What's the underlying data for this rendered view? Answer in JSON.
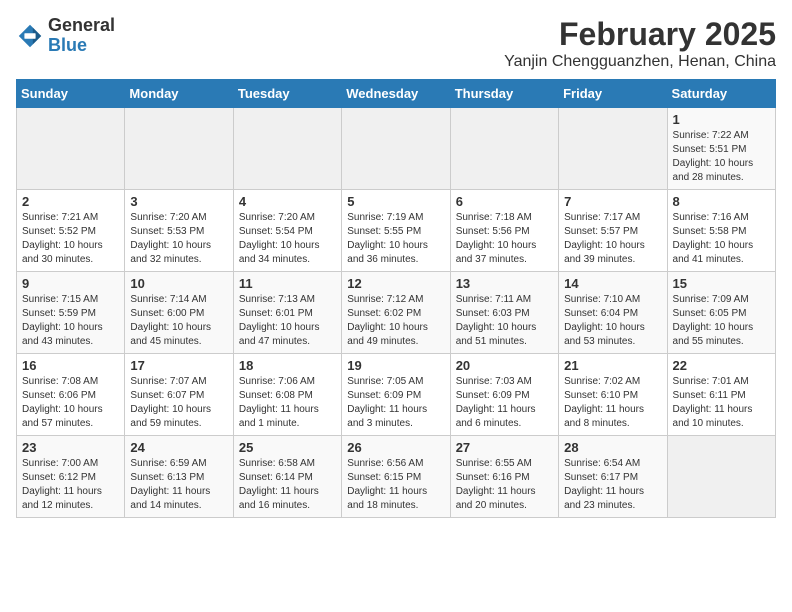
{
  "logo": {
    "general": "General",
    "blue": "Blue"
  },
  "title": "February 2025",
  "subtitle": "Yanjin Chengguanzhen, Henan, China",
  "weekdays": [
    "Sunday",
    "Monday",
    "Tuesday",
    "Wednesday",
    "Thursday",
    "Friday",
    "Saturday"
  ],
  "weeks": [
    [
      {
        "day": "",
        "info": ""
      },
      {
        "day": "",
        "info": ""
      },
      {
        "day": "",
        "info": ""
      },
      {
        "day": "",
        "info": ""
      },
      {
        "day": "",
        "info": ""
      },
      {
        "day": "",
        "info": ""
      },
      {
        "day": "1",
        "info": "Sunrise: 7:22 AM\nSunset: 5:51 PM\nDaylight: 10 hours and 28 minutes."
      }
    ],
    [
      {
        "day": "2",
        "info": "Sunrise: 7:21 AM\nSunset: 5:52 PM\nDaylight: 10 hours and 30 minutes."
      },
      {
        "day": "3",
        "info": "Sunrise: 7:20 AM\nSunset: 5:53 PM\nDaylight: 10 hours and 32 minutes."
      },
      {
        "day": "4",
        "info": "Sunrise: 7:20 AM\nSunset: 5:54 PM\nDaylight: 10 hours and 34 minutes."
      },
      {
        "day": "5",
        "info": "Sunrise: 7:19 AM\nSunset: 5:55 PM\nDaylight: 10 hours and 36 minutes."
      },
      {
        "day": "6",
        "info": "Sunrise: 7:18 AM\nSunset: 5:56 PM\nDaylight: 10 hours and 37 minutes."
      },
      {
        "day": "7",
        "info": "Sunrise: 7:17 AM\nSunset: 5:57 PM\nDaylight: 10 hours and 39 minutes."
      },
      {
        "day": "8",
        "info": "Sunrise: 7:16 AM\nSunset: 5:58 PM\nDaylight: 10 hours and 41 minutes."
      }
    ],
    [
      {
        "day": "9",
        "info": "Sunrise: 7:15 AM\nSunset: 5:59 PM\nDaylight: 10 hours and 43 minutes."
      },
      {
        "day": "10",
        "info": "Sunrise: 7:14 AM\nSunset: 6:00 PM\nDaylight: 10 hours and 45 minutes."
      },
      {
        "day": "11",
        "info": "Sunrise: 7:13 AM\nSunset: 6:01 PM\nDaylight: 10 hours and 47 minutes."
      },
      {
        "day": "12",
        "info": "Sunrise: 7:12 AM\nSunset: 6:02 PM\nDaylight: 10 hours and 49 minutes."
      },
      {
        "day": "13",
        "info": "Sunrise: 7:11 AM\nSunset: 6:03 PM\nDaylight: 10 hours and 51 minutes."
      },
      {
        "day": "14",
        "info": "Sunrise: 7:10 AM\nSunset: 6:04 PM\nDaylight: 10 hours and 53 minutes."
      },
      {
        "day": "15",
        "info": "Sunrise: 7:09 AM\nSunset: 6:05 PM\nDaylight: 10 hours and 55 minutes."
      }
    ],
    [
      {
        "day": "16",
        "info": "Sunrise: 7:08 AM\nSunset: 6:06 PM\nDaylight: 10 hours and 57 minutes."
      },
      {
        "day": "17",
        "info": "Sunrise: 7:07 AM\nSunset: 6:07 PM\nDaylight: 10 hours and 59 minutes."
      },
      {
        "day": "18",
        "info": "Sunrise: 7:06 AM\nSunset: 6:08 PM\nDaylight: 11 hours and 1 minute."
      },
      {
        "day": "19",
        "info": "Sunrise: 7:05 AM\nSunset: 6:09 PM\nDaylight: 11 hours and 3 minutes."
      },
      {
        "day": "20",
        "info": "Sunrise: 7:03 AM\nSunset: 6:09 PM\nDaylight: 11 hours and 6 minutes."
      },
      {
        "day": "21",
        "info": "Sunrise: 7:02 AM\nSunset: 6:10 PM\nDaylight: 11 hours and 8 minutes."
      },
      {
        "day": "22",
        "info": "Sunrise: 7:01 AM\nSunset: 6:11 PM\nDaylight: 11 hours and 10 minutes."
      }
    ],
    [
      {
        "day": "23",
        "info": "Sunrise: 7:00 AM\nSunset: 6:12 PM\nDaylight: 11 hours and 12 minutes."
      },
      {
        "day": "24",
        "info": "Sunrise: 6:59 AM\nSunset: 6:13 PM\nDaylight: 11 hours and 14 minutes."
      },
      {
        "day": "25",
        "info": "Sunrise: 6:58 AM\nSunset: 6:14 PM\nDaylight: 11 hours and 16 minutes."
      },
      {
        "day": "26",
        "info": "Sunrise: 6:56 AM\nSunset: 6:15 PM\nDaylight: 11 hours and 18 minutes."
      },
      {
        "day": "27",
        "info": "Sunrise: 6:55 AM\nSunset: 6:16 PM\nDaylight: 11 hours and 20 minutes."
      },
      {
        "day": "28",
        "info": "Sunrise: 6:54 AM\nSunset: 6:17 PM\nDaylight: 11 hours and 23 minutes."
      },
      {
        "day": "",
        "info": ""
      }
    ]
  ]
}
